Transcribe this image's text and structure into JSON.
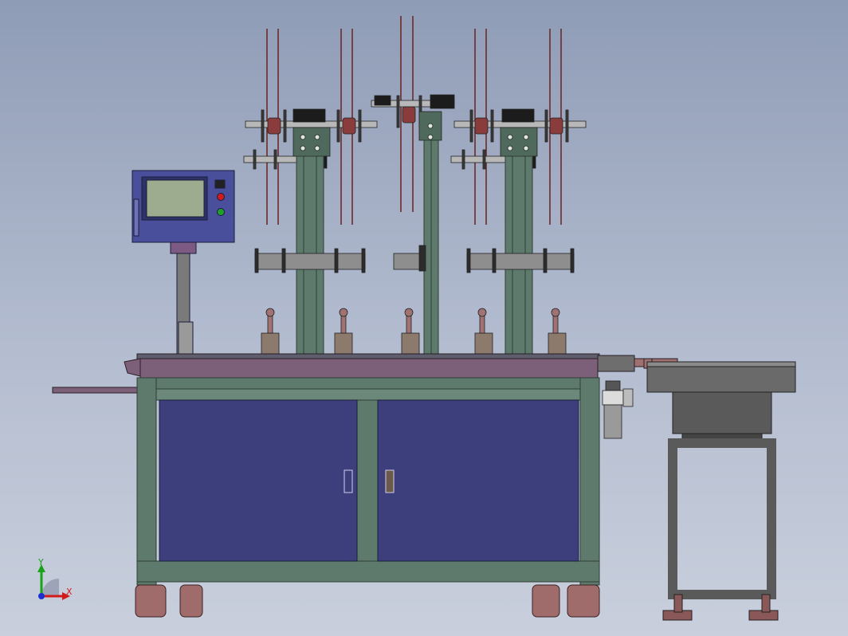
{
  "triad": {
    "x_label": "X",
    "y_label": "Y",
    "x_color": "#d11a1a",
    "y_color": "#19a319",
    "z_color": "#1a2fd1"
  },
  "colors": {
    "frame": "#5d7a6c",
    "frame_dark": "#3e5549",
    "cabinet": "#3d3f7d",
    "table_top": "#7c5f78",
    "panel": "#4a4f9c",
    "screen": "#9dab8e",
    "spool": "#8a4a4a",
    "metal": "#7e7e7e",
    "wheel": "#a06b6b"
  },
  "icons": {
    "control-panel": "hmi-screen",
    "red-button": "stop-button",
    "green-button": "start-button"
  }
}
